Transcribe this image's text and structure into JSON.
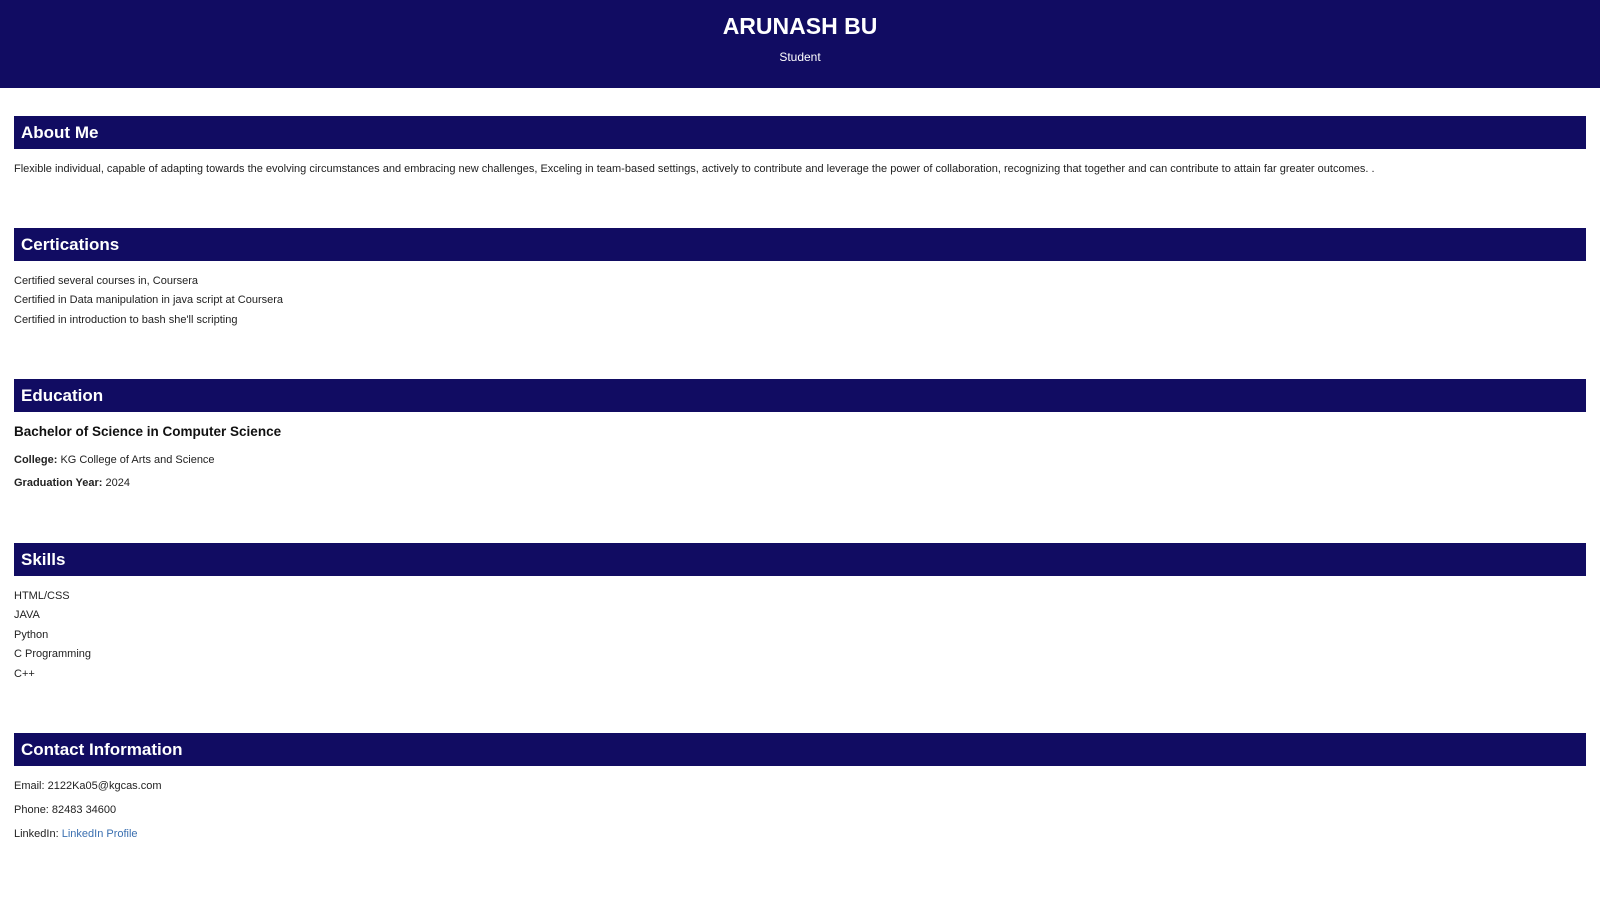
{
  "header": {
    "name": "ARUNASH BU",
    "role": "Student"
  },
  "about": {
    "heading": "About Me",
    "text": "Flexible individual, capable of adapting towards the evolving circumstances and embracing new challenges, Exceling in team-based settings, actively to contribute and leverage the power of collaboration, recognizing that together and can contribute to attain far greater outcomes. ."
  },
  "certifications": {
    "heading": "Certications",
    "items": [
      "Certified several courses in, Coursera",
      "Certified in Data manipulation in java script at Coursera",
      "Certified in introduction to bash she'll scripting"
    ]
  },
  "education": {
    "heading": "Education",
    "degree": "Bachelor of Science in Computer Science",
    "college_label": "College:",
    "college_value": "KG College of Arts and Science",
    "year_label": "Graduation Year:",
    "year_value": "2024"
  },
  "skills": {
    "heading": "Skills",
    "items": [
      "HTML/CSS",
      "JAVA",
      "Python",
      "C Programming",
      "C++"
    ]
  },
  "contact": {
    "heading": "Contact Information",
    "email": "Email: 2122Ka05@kgcas.com",
    "phone": "Phone: 82483 34600",
    "linkedin_label": "LinkedIn:",
    "linkedin_link": "LinkedIn Profile"
  },
  "colors": {
    "bar": "#110c62",
    "link": "#3a6fb0"
  }
}
